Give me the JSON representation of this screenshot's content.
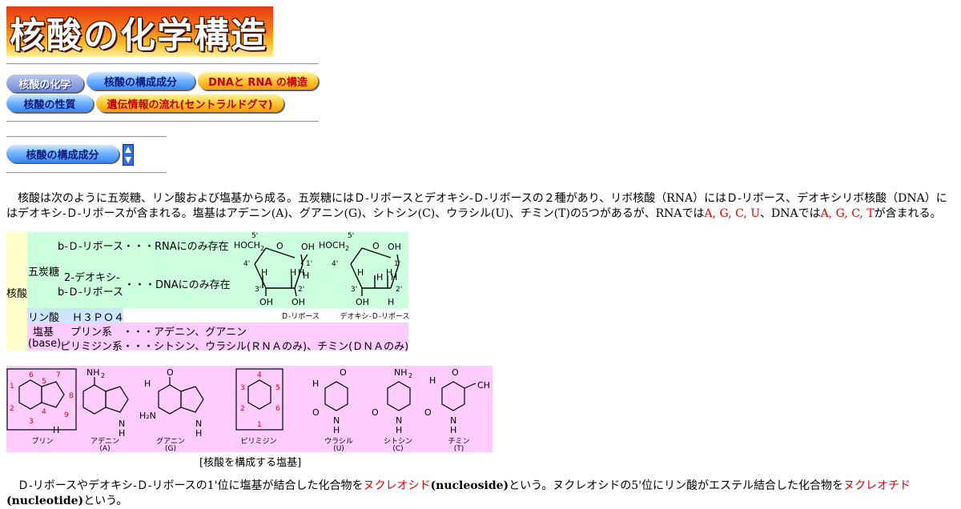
{
  "title": "核酸の化学構造",
  "nav": {
    "row1": [
      "核酸の化学",
      "核酸の構成成分",
      "DNAと RNA の構造"
    ],
    "row2": [
      "核酸の性質",
      "遺伝情報の流れ(セントラルドグマ)"
    ]
  },
  "section_button": "核酸の構成成分",
  "intro": {
    "text1": "　核酸は次のように五炭糖、リン酸および塩基から成る。五炭糖にはＤ-リボースとデオキシ-Ｄ-リボースの２種があり、リボ核酸（RNA）にはＤ-リボース、デオキシリボ核酸（DNA）にはデオキシ-Ｄ-リボースが含まれる。塩基はアデニン(A)、グアニン(G)、シトシン(C)、ウラシル(U)、チミン(T)の5つがあるが、RNAでは",
    "rna_bases": "A, G, C, U",
    "text2": "、DNAでは",
    "dna_bases": "A, G, C, T",
    "text3": "が含まれる。"
  },
  "table": {
    "root": "核酸",
    "sugar_label": "五炭糖",
    "ribose_line": "b-Ｄ-リボース・・・RNAにのみ存在",
    "deoxy_line1": "2-デオキシ-",
    "deoxy_line2": "b-Ｄ-リボース",
    "deoxy_dna": "・・・DNAにのみ存在",
    "ribose_caption": "Ｄ-リボース",
    "deoxy_caption": "デオキシ-Ｄ-リボース",
    "phosphate_label": "リン酸",
    "phosphate_formula": "Ｈ３ＰＯ４",
    "base_label": "塩基",
    "base_label2": "(base)",
    "purine_line": "プリン系　・・・アデニン、グアニン",
    "pyrimidine_line": "ピリミジン系・・・シトシン、ウラシル(ＲＮＡのみ)、チミン(ＤＮＡのみ)"
  },
  "bases_figure": {
    "labels": [
      "プリン",
      "アデニン",
      "グアニン",
      "ピリミジン",
      "ウラシル",
      "シトシン",
      "チミン"
    ],
    "abbr": [
      "",
      "(A)",
      "(G)",
      "",
      "(U)",
      "(C)",
      "(T)"
    ],
    "caption": "[核酸を構成する塩基]"
  },
  "outro": {
    "t1": "　Ｄ-リボースやデオキシ-Ｄ-リボースの1'位に塩基が結合した化合物を",
    "nucleoside_jp": "ヌクレオシド",
    "nucleoside_en": "(nucleoside)",
    "t2": "という。ヌクレオシドの5'位にリン酸がエステル結合した化合物を",
    "nucleotide_jp": "ヌクレオチド",
    "nucleotide_en": "(nucleotide)",
    "t3": "という。"
  },
  "colors": {
    "sugar_bg": "#ccffdd",
    "base_bg": "#ffccff",
    "root_bg": "#ffffcc",
    "phosphate_bg": "#cce6ff",
    "accent_red": "#e00000"
  }
}
